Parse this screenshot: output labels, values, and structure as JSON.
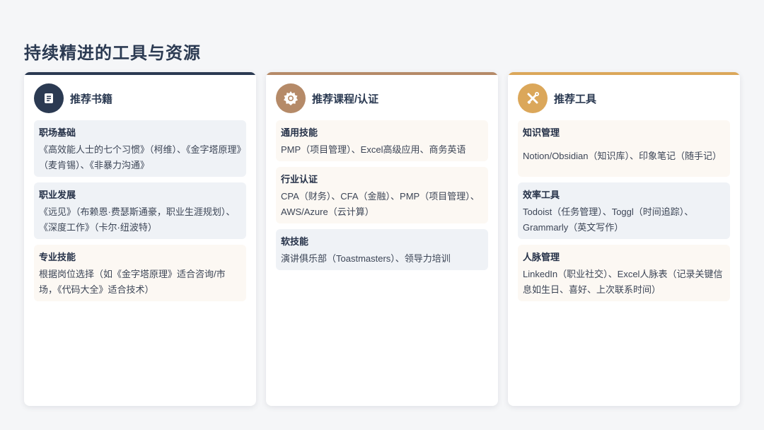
{
  "page": {
    "title": "持续精进的工具与资源"
  },
  "colors": {
    "navy": "#2b3a52",
    "brown": "#b58a68",
    "gold": "#dba75a",
    "item_gray": "#eff2f6",
    "item_warm": "#fcf8f3"
  },
  "cards": [
    {
      "title": "推荐书籍",
      "icon": "book-icon",
      "items": [
        {
          "title": "职场基础",
          "desc": "《高效能人士的七个习惯》（柯维）、《金字塔原理》（麦肯锡）、《非暴力沟通》"
        },
        {
          "title": "职业发展",
          "desc": "《远见》（布赖恩·费瑟斯通豪，职业生涯规划）、《深度工作》（卡尔·纽波特）"
        },
        {
          "title": "专业技能",
          "desc": "根据岗位选择（如《金字塔原理》适合咨询/市场，《代码大全》适合技术）"
        }
      ]
    },
    {
      "title": "推荐课程/认证",
      "icon": "certificate-badge-icon",
      "items": [
        {
          "title": "通用技能",
          "desc": "PMP（项目管理）、Excel高级应用、商务英语"
        },
        {
          "title": "行业认证",
          "desc": "CPA（财务）、CFA（金融）、PMP（项目管理）、AWS/Azure（云计算）"
        },
        {
          "title": "软技能",
          "desc": "演讲俱乐部（Toastmasters）、领导力培训"
        }
      ]
    },
    {
      "title": "推荐工具",
      "icon": "tools-icon",
      "items": [
        {
          "title": "知识管理",
          "desc": "Notion/Obsidian（知识库）、印象笔记（随手记）"
        },
        {
          "title": "效率工具",
          "desc": "Todoist（任务管理）、Toggl（时间追踪）、Grammarly（英文写作）"
        },
        {
          "title": "人脉管理",
          "desc": "LinkedIn（职业社交）、Excel人脉表（记录关键信息如生日、喜好、上次联系时间）"
        }
      ]
    }
  ]
}
